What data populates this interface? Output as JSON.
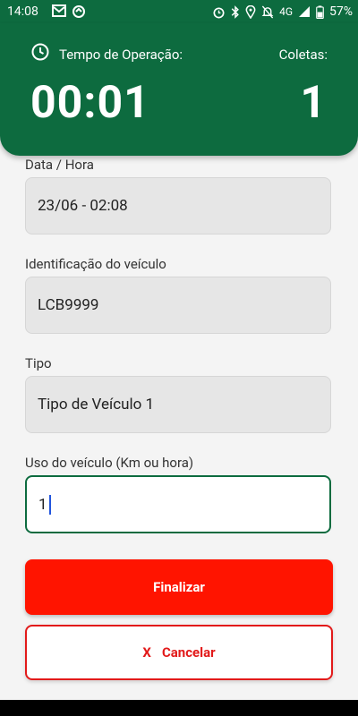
{
  "status_bar": {
    "time": "14:08",
    "network": "4G",
    "battery": "57%"
  },
  "header": {
    "operation_label": "Tempo de Operação:",
    "operation_value": "00:01",
    "collections_label": "Coletas:",
    "collections_value": "1",
    "bg_color": "#0d6b3f"
  },
  "form": {
    "datetime": {
      "label": "Data / Hora",
      "value": "23/06 - 02:08"
    },
    "vehicle_id": {
      "label": "Identificação do veículo",
      "value": "LCB9999"
    },
    "type": {
      "label": "Tipo",
      "value": "Tipo de Veículo 1"
    },
    "usage": {
      "label": "Uso do veículo (Km ou hora)",
      "value": "1"
    }
  },
  "buttons": {
    "finish": "Finalizar",
    "cancel_icon": "X",
    "cancel": "Cancelar"
  }
}
